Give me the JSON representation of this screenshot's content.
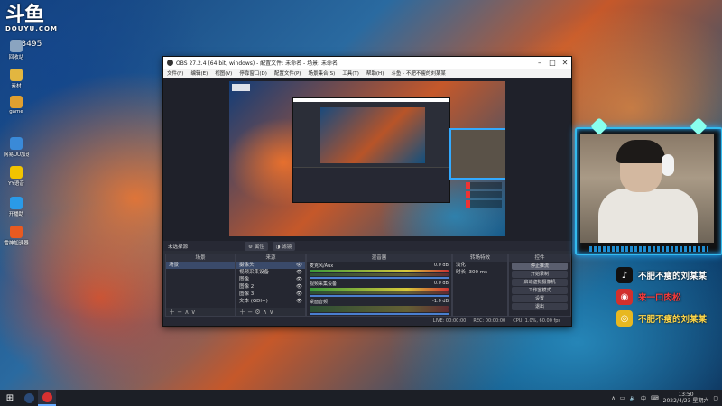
{
  "desktop": {
    "logo_main": "斗鱼",
    "logo_sub": "DOUYU.COM",
    "room_id": "433495",
    "icons": [
      {
        "label": "回收站",
        "color": "#8aa4c0"
      },
      {
        "label": "素材",
        "color": "#e2b640"
      },
      {
        "label": "game",
        "color": "#e0a030"
      },
      {
        "label": "网易UU加速器",
        "color": "#3a8ad8"
      },
      {
        "label": "YY语音",
        "color": "#f2c400"
      },
      {
        "label": "开播助",
        "color": "#2a9ae8"
      },
      {
        "label": "雷神加速器",
        "color": "#e85a20"
      }
    ]
  },
  "obs": {
    "title": "OBS 27.2.4 (64 bit, windows) - 配置文件: 未命名 - 场景: 未命名",
    "menu": [
      "文件(F)",
      "编辑(E)",
      "视图(V)",
      "停靠窗口(D)",
      "配置文件(P)",
      "场景集合(S)",
      "工具(T)",
      "帮助(H)",
      "斗鱼 - 不肥不瘦的刘某某"
    ],
    "toolbar": {
      "label": "未选择源",
      "properties": "属性",
      "filters": "滤镜"
    },
    "scenes": {
      "title": "场景",
      "items": [
        "场景"
      ]
    },
    "sources": {
      "title": "来源",
      "items": [
        "摄像头",
        "视频采集设备",
        "图像",
        "图像 2",
        "图像 3",
        "文本 (GDI+)"
      ]
    },
    "mixer": {
      "title": "混音器",
      "channels": [
        {
          "name": "麦克风/Aux",
          "db": "0.0 dB"
        },
        {
          "name": "视频采集设备",
          "db": "0.0 dB"
        },
        {
          "name": "桌面音频",
          "db": "-1.0 dB"
        }
      ]
    },
    "transitions": {
      "title": "转场特效",
      "type": "淡化",
      "duration_label": "时长",
      "duration": "300 ms"
    },
    "controls": {
      "title": "控件",
      "buttons": [
        "停止推流",
        "开始录制",
        "启动虚拟摄像机",
        "工作室模式",
        "设置",
        "退出"
      ]
    },
    "status": {
      "live": "LIVE: 00:00:00",
      "rec": "REC: 00:00:00",
      "cpu": "CPU: 1.0%, 60.00 fps"
    }
  },
  "social": [
    {
      "platform": "tiktok-icon",
      "text": "不肥不瘦的刘某某",
      "color": "#ffffff",
      "bg": "#111111",
      "glyph": "♪"
    },
    {
      "platform": "weibo-red-icon",
      "text": "来一口肉松",
      "color": "#ff3b3b",
      "bg": "#d2302d",
      "glyph": "◉"
    },
    {
      "platform": "weibo-icon",
      "text": "不肥不瘦的刘某某",
      "color": "#ffd84a",
      "bg": "#e8b820",
      "glyph": "◎"
    }
  ],
  "taskbar": {
    "time": "13:50",
    "date": "2022/4/23 星期六",
    "ime": "中",
    "apps": [
      {
        "name": "steam",
        "color": "#2a4a78"
      },
      {
        "name": "obs",
        "color": "#d83030"
      }
    ]
  }
}
